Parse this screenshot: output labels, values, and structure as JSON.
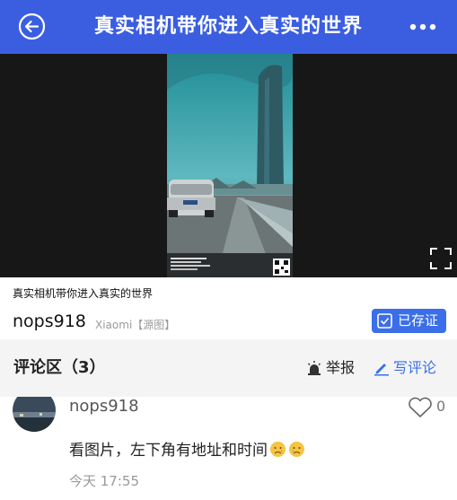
{
  "header": {
    "title": "真实相机带你进入真实的世界",
    "back_icon": "back-arrow-circle-icon",
    "more_icon": "more-dots-icon"
  },
  "colors": {
    "brand": "#3b5ee0",
    "accent": "#3b6ee8",
    "muted": "#9a9a9a"
  },
  "post": {
    "caption": "真实相机带你进入真实的世界",
    "author": "nops918",
    "device": "Xiaomi【源图】",
    "saved_badge": "已存证"
  },
  "comments_section": {
    "title": "评论区（3）",
    "report_label": "举报",
    "write_label": "写评论"
  },
  "comments": [
    {
      "author": "nops918",
      "text": "看图片，左下角有地址和时间",
      "likes": "0",
      "time": "今天 17:55"
    }
  ]
}
